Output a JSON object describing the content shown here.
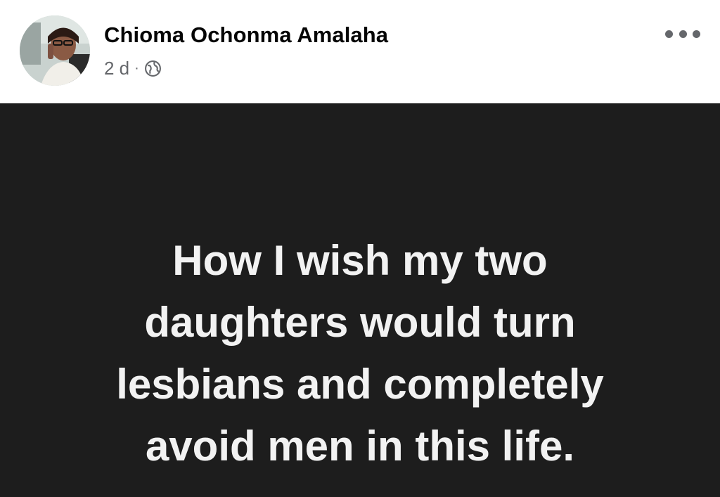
{
  "post": {
    "author": {
      "name": "Chioma Ochonma Amalaha"
    },
    "meta": {
      "time": "2 d",
      "separator": "·",
      "audience_icon": "globe-icon"
    },
    "more_icon": "more-options-icon",
    "text_lines": [
      "How I wish my two",
      "daughters would turn",
      "lesbians and completely",
      "avoid men in this life."
    ],
    "colors": {
      "background": "#1d1d1d",
      "text": "#f2f2f2",
      "meta": "#65676b",
      "name": "#050505"
    }
  }
}
